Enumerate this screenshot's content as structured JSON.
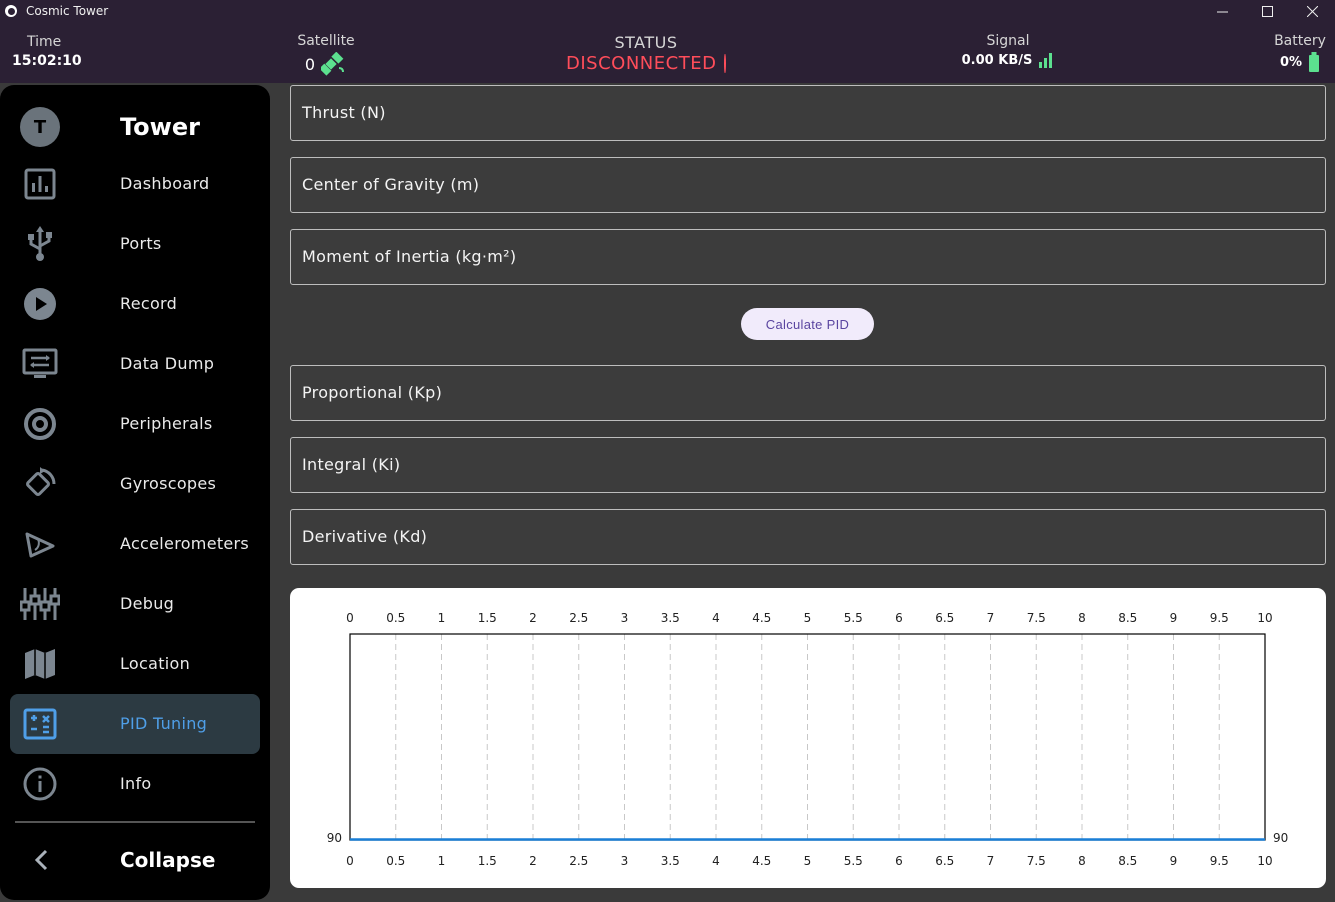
{
  "window": {
    "title": "Cosmic Tower",
    "controls": [
      "—",
      "☐",
      "✕"
    ]
  },
  "header": {
    "time": {
      "label": "Time",
      "value": "15:02:10"
    },
    "satellite": {
      "label": "Satellite",
      "value": "0"
    },
    "status": {
      "label": "STATUS",
      "value": "DISCONNECTED",
      "color": "#ff4d5a"
    },
    "signal": {
      "label": "Signal",
      "value": "0.00 KB/S"
    },
    "battery": {
      "label": "Battery",
      "value": "0%"
    },
    "accent": "#5ce08f"
  },
  "sidebar": {
    "avatar_letter": "T",
    "brand": "Tower",
    "items": [
      {
        "label": "Dashboard",
        "icon": "bar-chart-icon"
      },
      {
        "label": "Ports",
        "icon": "usb-icon"
      },
      {
        "label": "Record",
        "icon": "play-icon"
      },
      {
        "label": "Data Dump",
        "icon": "monitor-icon"
      },
      {
        "label": "Peripherals",
        "icon": "at-sign-icon"
      },
      {
        "label": "Gyroscopes",
        "icon": "rotate-icon"
      },
      {
        "label": "Accelerometers",
        "icon": "angle-icon"
      },
      {
        "label": "Debug",
        "icon": "sliders-icon"
      },
      {
        "label": "Location",
        "icon": "map-icon"
      },
      {
        "label": "PID Tuning",
        "icon": "calculator-icon",
        "active": true
      },
      {
        "label": "Info",
        "icon": "info-icon"
      }
    ],
    "collapse_label": "Collapse",
    "active_color": "#4f9fe8"
  },
  "inputs": {
    "thrust": "Thrust (N)",
    "cog": "Center of Gravity (m)",
    "moi": "Moment of Inertia (kg·m²)"
  },
  "calculate_label": "Calculate PID",
  "outputs": {
    "kp": "Proportional (Kp)",
    "ki": "Integral (Ki)",
    "kd": "Derivative (Kd)"
  },
  "chart_data": {
    "type": "line",
    "x_ticks": [
      "0",
      "0.5",
      "1",
      "1.5",
      "2",
      "2.5",
      "3",
      "3.5",
      "4",
      "4.5",
      "5",
      "5.5",
      "6",
      "6.5",
      "7",
      "7.5",
      "8",
      "8.5",
      "9",
      "9.5",
      "10"
    ],
    "xlim": [
      0,
      10
    ],
    "y_tick_left": "90",
    "y_tick_right": "90",
    "grid": "vertical dashed",
    "series": [
      {
        "x": [
          0,
          10
        ],
        "y": [
          90,
          90
        ],
        "color": "#1a7fd6"
      }
    ]
  }
}
